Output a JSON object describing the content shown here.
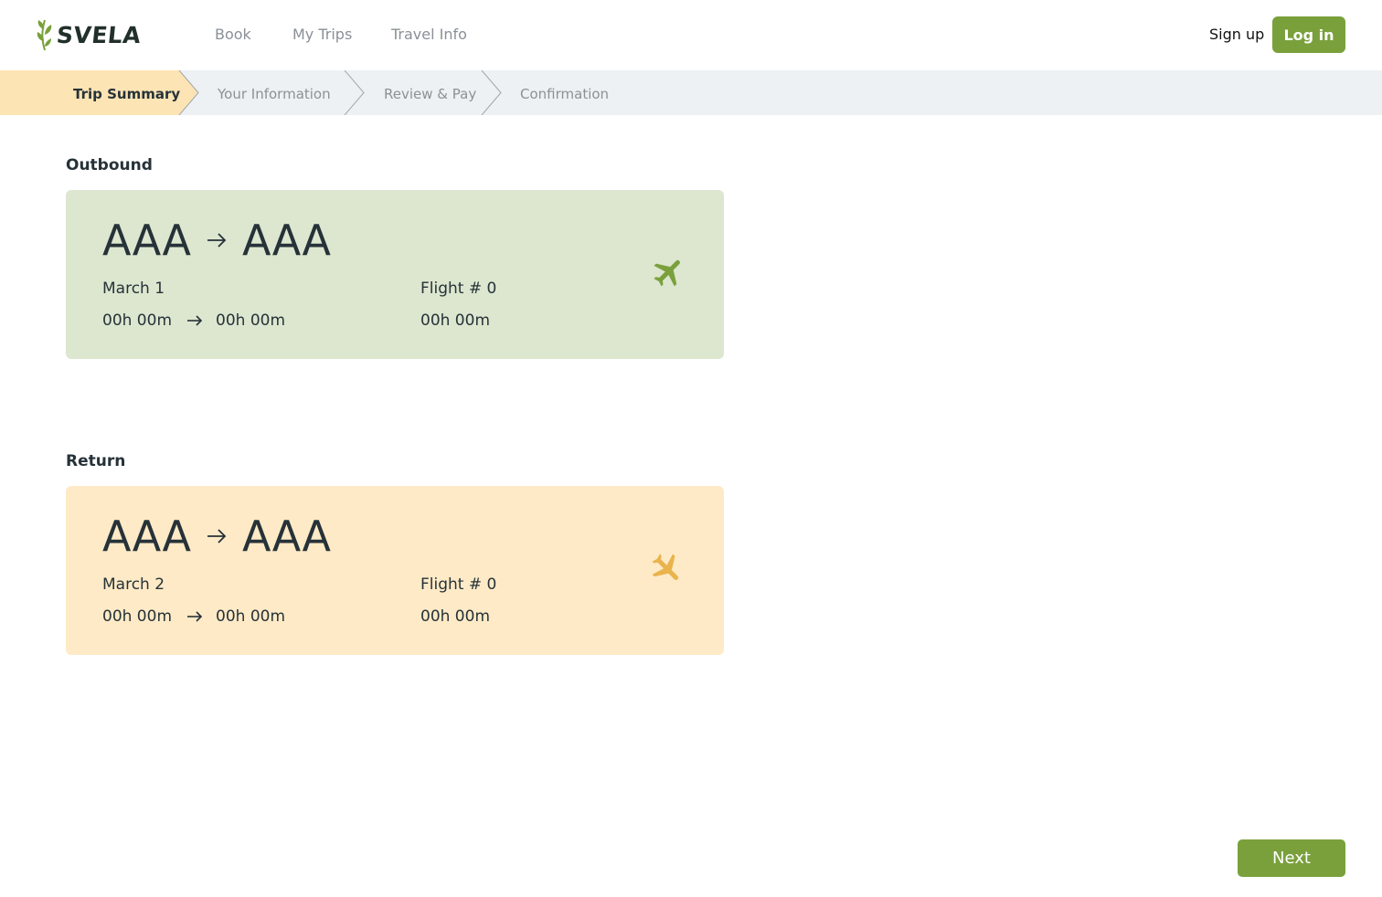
{
  "brand": {
    "name": "SVELA",
    "logo_icon": "leaf-icon"
  },
  "nav": {
    "items": [
      {
        "label": "Book"
      },
      {
        "label": "My Trips"
      },
      {
        "label": "Travel Info"
      }
    ]
  },
  "auth": {
    "signup_label": "Sign up",
    "login_label": "Log in"
  },
  "stepper": {
    "steps": [
      {
        "label": "Trip Summary",
        "active": true
      },
      {
        "label": "Your Information",
        "active": false
      },
      {
        "label": "Review & Pay",
        "active": false
      },
      {
        "label": "Confirmation",
        "active": false
      }
    ]
  },
  "outbound": {
    "title": "Outbound",
    "from": "AAA",
    "to": "AAA",
    "date": "March 1",
    "flight_number": "Flight # 0",
    "depart_time": "00h 00m",
    "arrive_time": "00h 00m",
    "duration": "00h 00m",
    "icon": "plane-takeoff-icon"
  },
  "return": {
    "title": "Return",
    "from": "AAA",
    "to": "AAA",
    "date": "March 2",
    "flight_number": "Flight # 0",
    "depart_time": "00h 00m",
    "arrive_time": "00h 00m",
    "duration": "00h 00m",
    "icon": "plane-landing-icon"
  },
  "footer": {
    "next_label": "Next"
  },
  "colors": {
    "accent_green": "#7aa03c",
    "outbound_bg": "#dde6cf",
    "return_bg": "#feeac6",
    "active_step_bg": "#fde4b4",
    "stepper_bg": "#edf1f3",
    "return_plane": "#e9b44c",
    "outbound_plane": "#7aa03c"
  }
}
